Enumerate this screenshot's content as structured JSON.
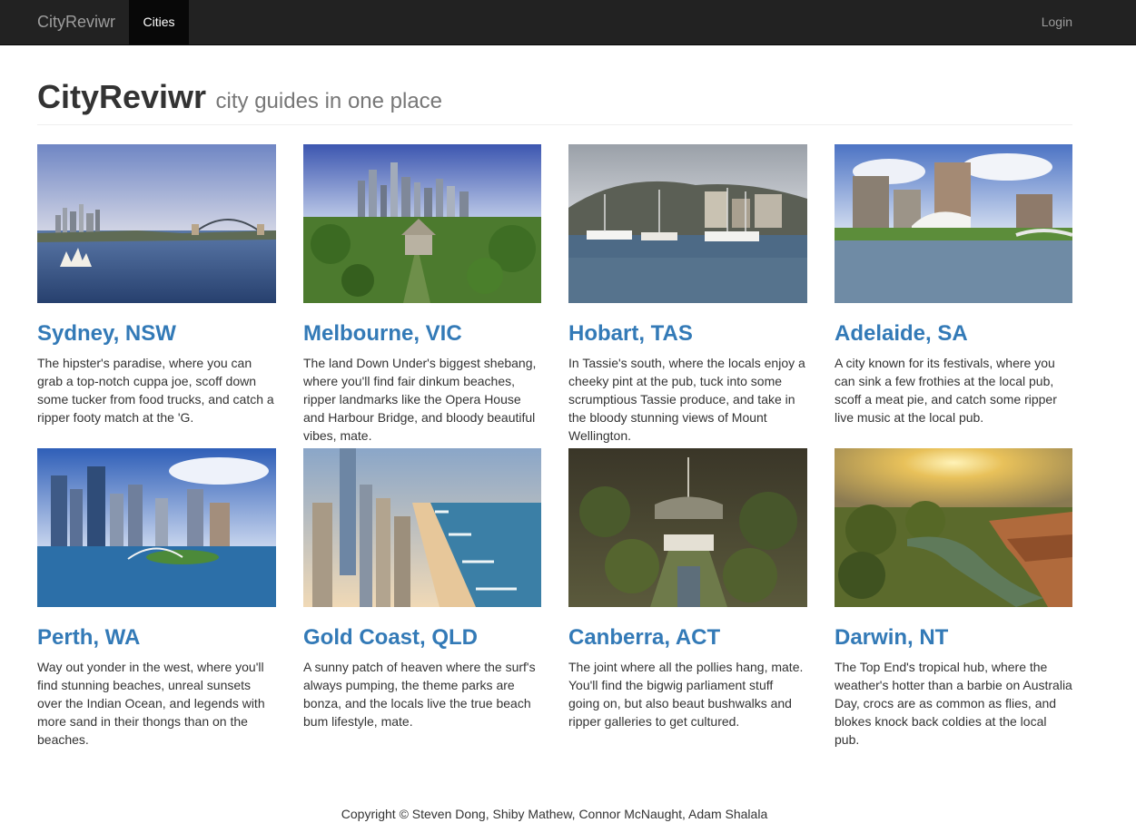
{
  "navbar": {
    "brand": "CityReviwr",
    "cities_label": "Cities",
    "login_label": "Login"
  },
  "header": {
    "title": "CityReviwr",
    "subtitle": "city guides in one place"
  },
  "cities": [
    {
      "name": "Sydney, NSW",
      "desc": "The hipster's paradise, where you can grab a top-notch cuppa joe, scoff down some tucker from food trucks, and catch a ripper footy match at the 'G."
    },
    {
      "name": "Melbourne, VIC",
      "desc": "The land Down Under's biggest shebang, where you'll find fair dinkum beaches, ripper landmarks like the Opera House and Harbour Bridge, and bloody beautiful vibes, mate."
    },
    {
      "name": "Hobart, TAS",
      "desc": "In Tassie's south, where the locals enjoy a cheeky pint at the pub, tuck into some scrumptious Tassie produce, and take in the bloody stunning views of Mount Wellington."
    },
    {
      "name": "Adelaide, SA",
      "desc": "A city known for its festivals, where you can sink a few frothies at the local pub, scoff a meat pie, and catch some ripper live music at the local pub."
    },
    {
      "name": "Perth, WA",
      "desc": "Way out yonder in the west, where you'll find stunning beaches, unreal sunsets over the Indian Ocean, and legends with more sand in their thongs than on the beaches."
    },
    {
      "name": "Gold Coast, QLD",
      "desc": "A sunny patch of heaven where the surf's always pumping, the theme parks are bonza, and the locals live the true beach bum lifestyle, mate."
    },
    {
      "name": "Canberra, ACT",
      "desc": "The joint where all the pollies hang, mate. You'll find the bigwig parliament stuff going on, but also beaut bushwalks and ripper galleries to get cultured."
    },
    {
      "name": "Darwin, NT",
      "desc": "The Top End's tropical hub, where the weather's hotter than a barbie on Australia Day, crocs are as common as flies, and blokes knock back coldies at the local pub."
    }
  ],
  "footer": {
    "copyright": "Copyright © Steven Dong, Shiby Mathew, Connor McNaught, Adam Shalala"
  },
  "colors": {
    "navbar_bg": "#222222",
    "nav_active_bg": "#080808",
    "link": "#337ab7",
    "muted": "#777777"
  }
}
